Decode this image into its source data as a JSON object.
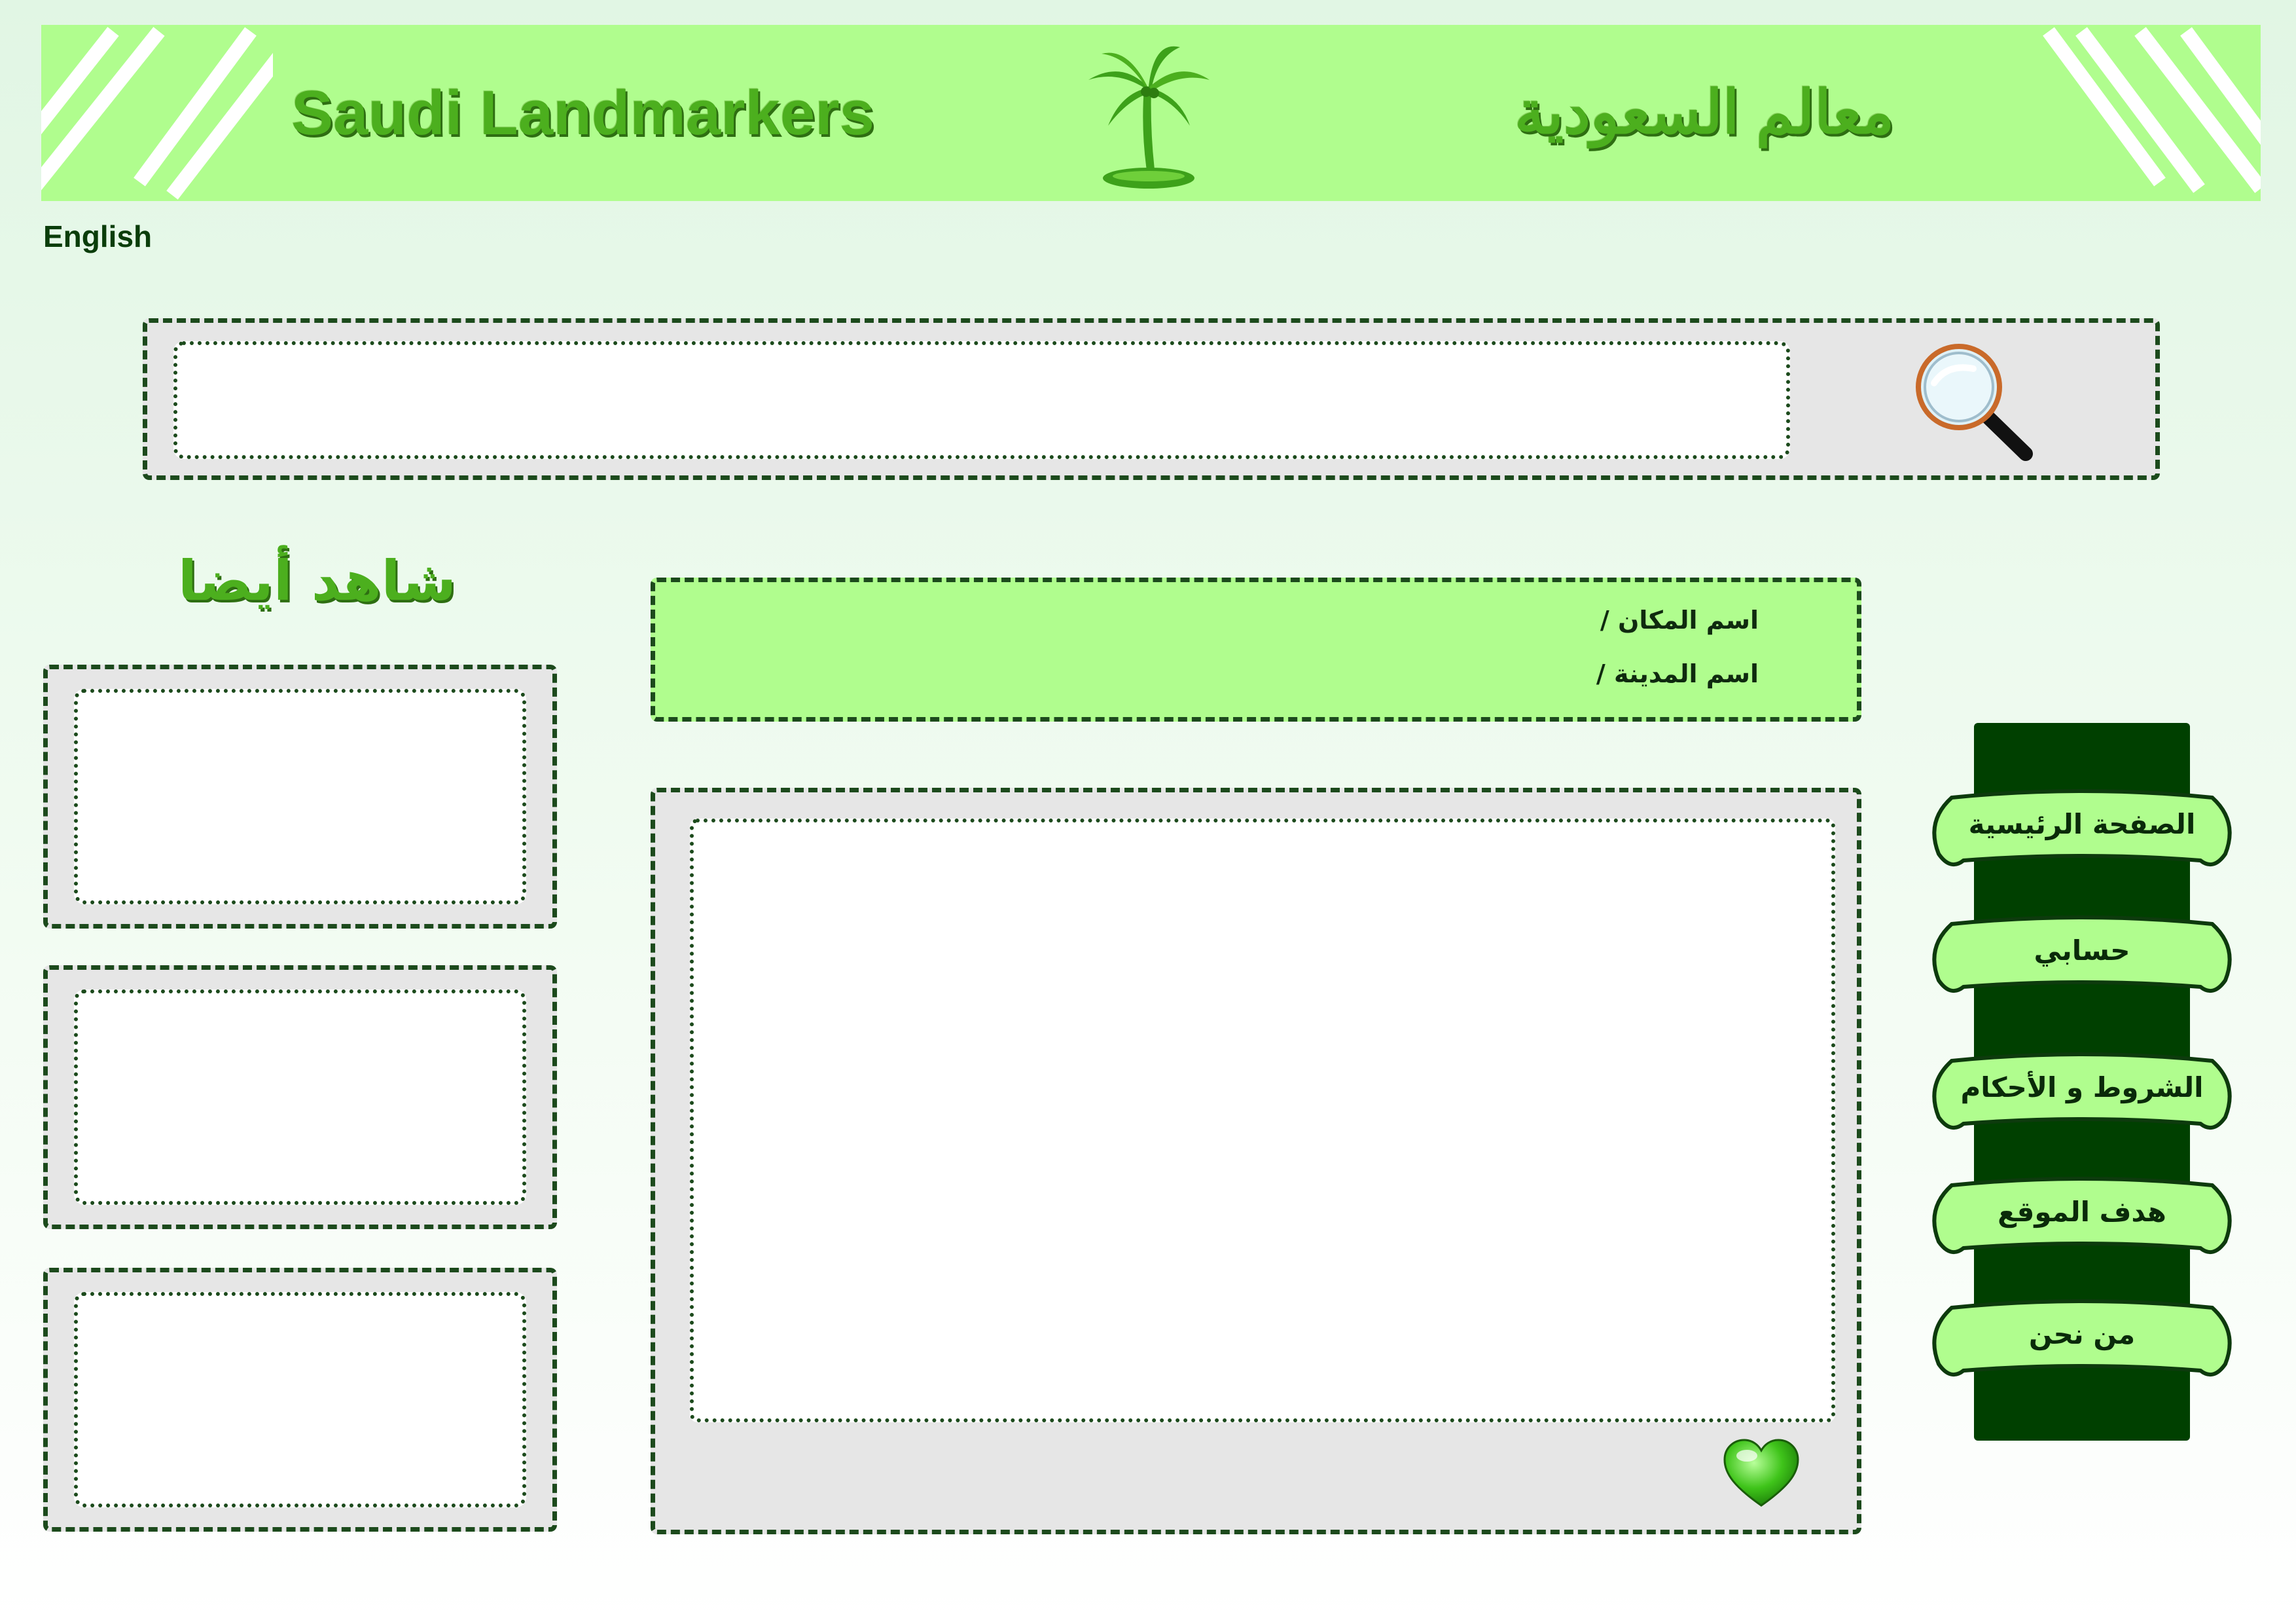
{
  "header": {
    "title_en": "Saudi Landmarkers",
    "title_ar": "معالم السعودية",
    "logo_icon": "palm-tree-icon"
  },
  "language_link": "English",
  "search": {
    "placeholder": "",
    "icon": "magnifier-icon"
  },
  "see_also": {
    "title": "شاهد أيضا",
    "cards": [
      {},
      {},
      {}
    ]
  },
  "place_info": {
    "place_name_label": "اسم المكان  /",
    "city_name_label": "اسم المدينة  /"
  },
  "content": {
    "favorite_icon": "heart-icon"
  },
  "nav": {
    "items": [
      {
        "label": "الصفحة الرئيسية"
      },
      {
        "label": "حسابي"
      },
      {
        "label": "الشروط و الأحكام"
      },
      {
        "label": "هدف الموقع"
      },
      {
        "label": "من نحن"
      }
    ]
  },
  "colors": {
    "header_bg": "#b0fd8e",
    "accent_green": "#4caf1e",
    "dark_green": "#004000",
    "panel_gray": "#e6e6e6",
    "border": "#1c4a1c"
  }
}
